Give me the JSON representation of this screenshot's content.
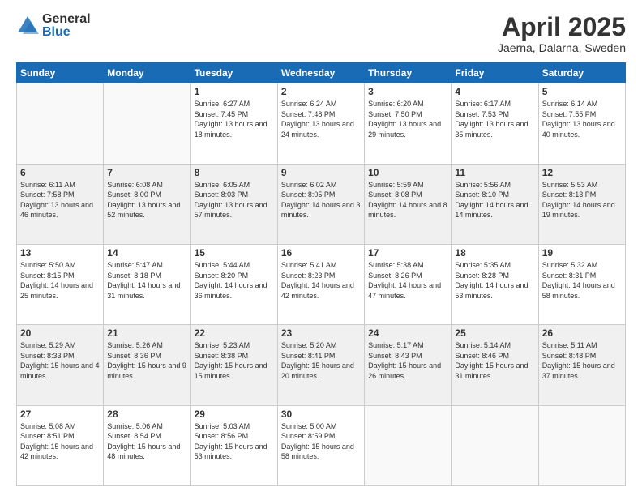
{
  "header": {
    "logo_general": "General",
    "logo_blue": "Blue",
    "title": "April 2025",
    "location": "Jaerna, Dalarna, Sweden"
  },
  "weekdays": [
    "Sunday",
    "Monday",
    "Tuesday",
    "Wednesday",
    "Thursday",
    "Friday",
    "Saturday"
  ],
  "weeks": [
    [
      {
        "day": "",
        "info": ""
      },
      {
        "day": "",
        "info": ""
      },
      {
        "day": "1",
        "info": "Sunrise: 6:27 AM\nSunset: 7:45 PM\nDaylight: 13 hours and 18 minutes."
      },
      {
        "day": "2",
        "info": "Sunrise: 6:24 AM\nSunset: 7:48 PM\nDaylight: 13 hours and 24 minutes."
      },
      {
        "day": "3",
        "info": "Sunrise: 6:20 AM\nSunset: 7:50 PM\nDaylight: 13 hours and 29 minutes."
      },
      {
        "day": "4",
        "info": "Sunrise: 6:17 AM\nSunset: 7:53 PM\nDaylight: 13 hours and 35 minutes."
      },
      {
        "day": "5",
        "info": "Sunrise: 6:14 AM\nSunset: 7:55 PM\nDaylight: 13 hours and 40 minutes."
      }
    ],
    [
      {
        "day": "6",
        "info": "Sunrise: 6:11 AM\nSunset: 7:58 PM\nDaylight: 13 hours and 46 minutes."
      },
      {
        "day": "7",
        "info": "Sunrise: 6:08 AM\nSunset: 8:00 PM\nDaylight: 13 hours and 52 minutes."
      },
      {
        "day": "8",
        "info": "Sunrise: 6:05 AM\nSunset: 8:03 PM\nDaylight: 13 hours and 57 minutes."
      },
      {
        "day": "9",
        "info": "Sunrise: 6:02 AM\nSunset: 8:05 PM\nDaylight: 14 hours and 3 minutes."
      },
      {
        "day": "10",
        "info": "Sunrise: 5:59 AM\nSunset: 8:08 PM\nDaylight: 14 hours and 8 minutes."
      },
      {
        "day": "11",
        "info": "Sunrise: 5:56 AM\nSunset: 8:10 PM\nDaylight: 14 hours and 14 minutes."
      },
      {
        "day": "12",
        "info": "Sunrise: 5:53 AM\nSunset: 8:13 PM\nDaylight: 14 hours and 19 minutes."
      }
    ],
    [
      {
        "day": "13",
        "info": "Sunrise: 5:50 AM\nSunset: 8:15 PM\nDaylight: 14 hours and 25 minutes."
      },
      {
        "day": "14",
        "info": "Sunrise: 5:47 AM\nSunset: 8:18 PM\nDaylight: 14 hours and 31 minutes."
      },
      {
        "day": "15",
        "info": "Sunrise: 5:44 AM\nSunset: 8:20 PM\nDaylight: 14 hours and 36 minutes."
      },
      {
        "day": "16",
        "info": "Sunrise: 5:41 AM\nSunset: 8:23 PM\nDaylight: 14 hours and 42 minutes."
      },
      {
        "day": "17",
        "info": "Sunrise: 5:38 AM\nSunset: 8:26 PM\nDaylight: 14 hours and 47 minutes."
      },
      {
        "day": "18",
        "info": "Sunrise: 5:35 AM\nSunset: 8:28 PM\nDaylight: 14 hours and 53 minutes."
      },
      {
        "day": "19",
        "info": "Sunrise: 5:32 AM\nSunset: 8:31 PM\nDaylight: 14 hours and 58 minutes."
      }
    ],
    [
      {
        "day": "20",
        "info": "Sunrise: 5:29 AM\nSunset: 8:33 PM\nDaylight: 15 hours and 4 minutes."
      },
      {
        "day": "21",
        "info": "Sunrise: 5:26 AM\nSunset: 8:36 PM\nDaylight: 15 hours and 9 minutes."
      },
      {
        "day": "22",
        "info": "Sunrise: 5:23 AM\nSunset: 8:38 PM\nDaylight: 15 hours and 15 minutes."
      },
      {
        "day": "23",
        "info": "Sunrise: 5:20 AM\nSunset: 8:41 PM\nDaylight: 15 hours and 20 minutes."
      },
      {
        "day": "24",
        "info": "Sunrise: 5:17 AM\nSunset: 8:43 PM\nDaylight: 15 hours and 26 minutes."
      },
      {
        "day": "25",
        "info": "Sunrise: 5:14 AM\nSunset: 8:46 PM\nDaylight: 15 hours and 31 minutes."
      },
      {
        "day": "26",
        "info": "Sunrise: 5:11 AM\nSunset: 8:48 PM\nDaylight: 15 hours and 37 minutes."
      }
    ],
    [
      {
        "day": "27",
        "info": "Sunrise: 5:08 AM\nSunset: 8:51 PM\nDaylight: 15 hours and 42 minutes."
      },
      {
        "day": "28",
        "info": "Sunrise: 5:06 AM\nSunset: 8:54 PM\nDaylight: 15 hours and 48 minutes."
      },
      {
        "day": "29",
        "info": "Sunrise: 5:03 AM\nSunset: 8:56 PM\nDaylight: 15 hours and 53 minutes."
      },
      {
        "day": "30",
        "info": "Sunrise: 5:00 AM\nSunset: 8:59 PM\nDaylight: 15 hours and 58 minutes."
      },
      {
        "day": "",
        "info": ""
      },
      {
        "day": "",
        "info": ""
      },
      {
        "day": "",
        "info": ""
      }
    ]
  ]
}
